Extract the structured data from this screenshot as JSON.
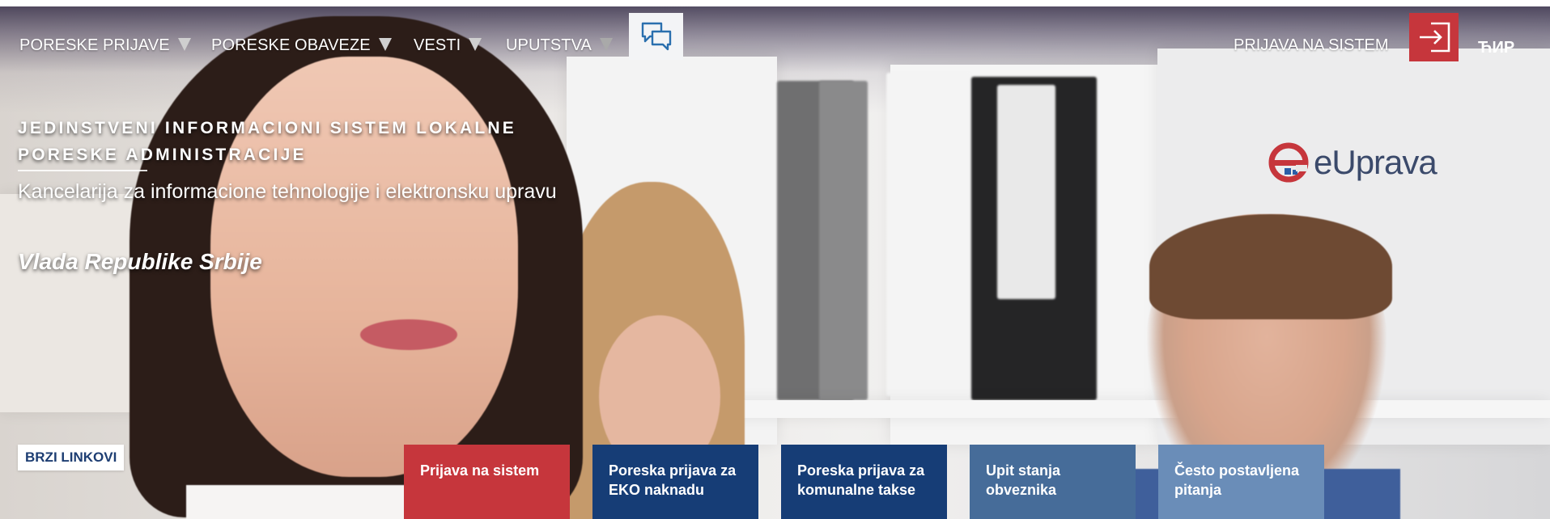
{
  "nav": {
    "items": [
      {
        "label": "PORESKE PRIJAVE"
      },
      {
        "label": "PORESKE OBAVEZE"
      },
      {
        "label": "VESTI"
      },
      {
        "label": "UPUTSTVA"
      }
    ],
    "login_label": "PRIJAVA NA SISTEM",
    "language_label": "ЋИР",
    "icons": {
      "chat": "chat-bubbles-icon",
      "login": "sign-in-icon"
    }
  },
  "hero": {
    "title": "JEDINSTVENI INFORMACIONI SISTEM LOKALNE PORESKE ADMINISTRACIJE",
    "subtitle": "Kancelarija za informacione tehnologije i elektronsku upravu",
    "government": "Vlada Republike Srbije"
  },
  "logo": {
    "text": "eUprava",
    "accent_color": "#c6363c",
    "text_color": "#3b4a6b"
  },
  "quick_links": {
    "label": "BRZI LINKOVI",
    "tiles": [
      {
        "label": "Prijava na sistem",
        "color": "#c6363c"
      },
      {
        "label": "Poreska prijava za EKO naknadu",
        "color": "#163d76"
      },
      {
        "label": "Poreska prijava za komunalne takse",
        "color": "#163d76"
      },
      {
        "label": "Upit stanja obveznika",
        "color": "#466c99"
      },
      {
        "label": "Često postavljena pitanja",
        "color": "#6a8db8"
      }
    ]
  },
  "colors": {
    "brand_red": "#c6363c",
    "brand_navy": "#163d76"
  }
}
